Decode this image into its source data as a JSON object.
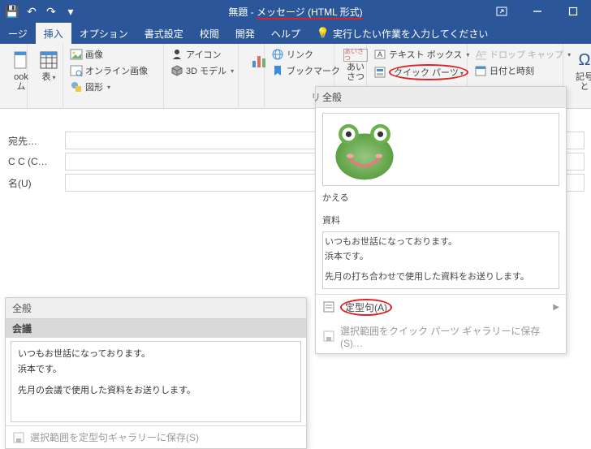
{
  "title": {
    "doc": "無題",
    "sep": "-",
    "format": "メッセージ (HTML 形式)"
  },
  "qat": {
    "save": "💾",
    "undo": "↶",
    "redo": "↷",
    "more": "▾"
  },
  "tabs": {
    "message": "ージ",
    "insert": "挿入",
    "options": "オプション",
    "format_text": "書式設定",
    "review": "校閲",
    "developer": "開発",
    "help": "ヘルプ",
    "tell_me": "実行したい作業を入力してください"
  },
  "ribbon": {
    "outlook_item": "ook\nム",
    "table": "表",
    "pictures": "画像",
    "online_pictures": "オンライン画像",
    "shapes": "図形",
    "icons": "アイコン",
    "models3d": "3D モデル",
    "chart": "",
    "link": "リンク",
    "bookmark": "ブックマーク",
    "aisatsu": "あいさつ\n",
    "text_box": "テキスト ボックス",
    "quick_parts": "クイック パーツ",
    "drop_cap": "ドロップ キャップ",
    "date_time": "日付と時刻",
    "symbol": "記号と"
  },
  "fields": {
    "to": "宛先…",
    "cc": "C C (C…",
    "subject": "名(U)"
  },
  "qp_popup": {
    "category": "全般",
    "left_cut": "リ",
    "entry1_title": "かえる",
    "entry2_title": "資料",
    "entry2_body": {
      "l1": "いつもお世話になっております。",
      "l2": "浜本です。",
      "l3": "先月の打ち合わせで使用した資料をお送りします。"
    },
    "menu_autotext": "定型句(A)",
    "menu_save": "選択範囲をクイック パーツ ギャラリーに保存(S)…"
  },
  "at_popup": {
    "category": "全般",
    "entry_title": "会議",
    "body": {
      "l1": "いつもお世話になっております。",
      "l2": "浜本です。",
      "l3": "先月の会議で使用した資料をお送りします。"
    },
    "footer": "選択範囲を定型句ギャラリーに保存(S)"
  }
}
